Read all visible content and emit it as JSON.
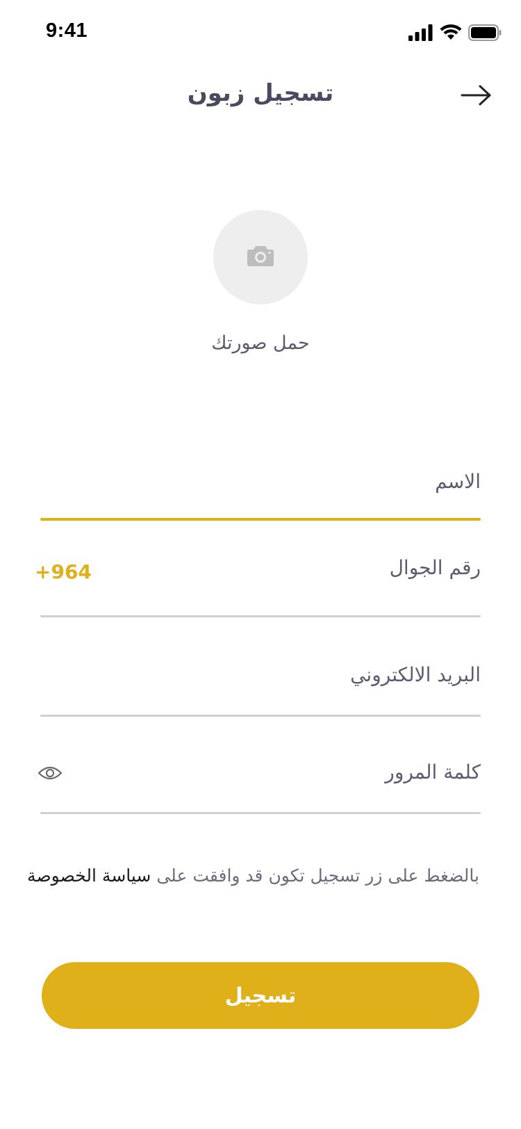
{
  "status_bar": {
    "time": "9:41",
    "icons": [
      "cellular-signal-icon",
      "wifi-icon",
      "battery-icon"
    ]
  },
  "header": {
    "title": "تسجيل زبون",
    "back_icon": "arrow-right-icon"
  },
  "avatar": {
    "icon": "camera-icon",
    "label": "حمل صورتك"
  },
  "form": {
    "name": {
      "label": "الاسم",
      "active": true
    },
    "phone": {
      "label": "رقم الجوال",
      "country_code": "+964"
    },
    "email": {
      "label": "البريد الالكتروني"
    },
    "password": {
      "label": "كلمة المرور",
      "toggle_icon": "eye-icon"
    }
  },
  "terms": {
    "text": "بالضغط على زر تسجيل تكون قد وافقت على",
    "link": "سياسة الخصوصة"
  },
  "submit": {
    "label": "تسجيل"
  },
  "colors": {
    "accent": "#e0b01b",
    "text_muted": "#5c5c6e",
    "title": "#4a4a5e",
    "divider": "#cfcfcf",
    "avatar_bg": "#eeeeee"
  }
}
